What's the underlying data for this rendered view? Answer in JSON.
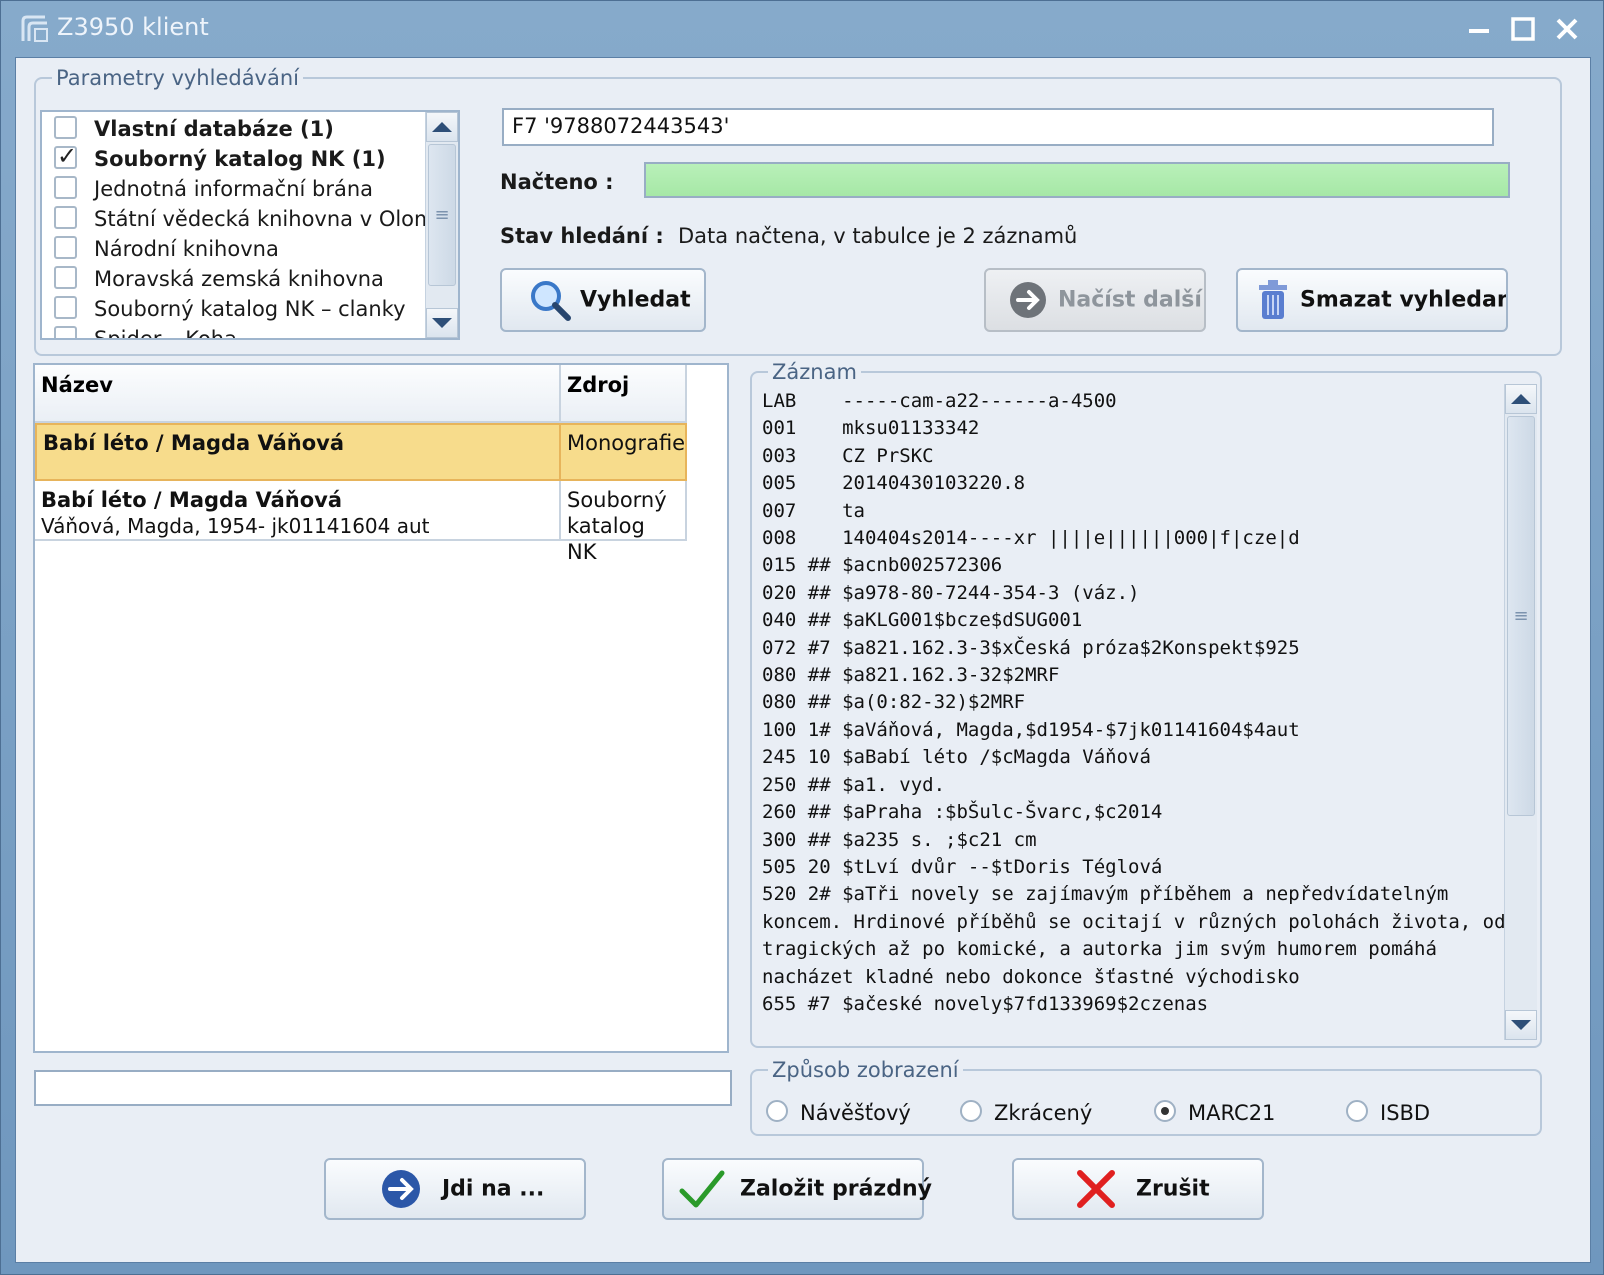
{
  "window": {
    "title": "Z3950 klient",
    "controls": [
      "minimize-icon",
      "maximize-icon",
      "close-icon"
    ]
  },
  "search_params": {
    "legend": "Parametry vyhledávání",
    "databases": [
      {
        "label": "Vlastní databáze (1)",
        "checked": false,
        "bold": true
      },
      {
        "label": "Souborný katalog NK (1)",
        "checked": true,
        "bold": true
      },
      {
        "label": "Jednotná informační brána",
        "checked": false,
        "bold": false
      },
      {
        "label": "Státní vědecká knihovna v Olomouci",
        "checked": false,
        "bold": false
      },
      {
        "label": "Národní knihovna",
        "checked": false,
        "bold": false
      },
      {
        "label": "Moravská zemská knihovna",
        "checked": false,
        "bold": false
      },
      {
        "label": "Souborný katalog NK – clanky",
        "checked": false,
        "bold": false
      },
      {
        "label": "Spider – Koha",
        "checked": false,
        "bold": false
      }
    ],
    "query": "F7 '9788072443543'",
    "loaded_label": "Načteno :",
    "loaded_progress": 1.0,
    "status_label": "Stav hledání :",
    "status_text": "Data načtena, v tabulce je 2 záznamů",
    "search_button": "Vyhledat",
    "load_more_button": "Načíst další",
    "clear_button": "Smazat vyhledané"
  },
  "results": {
    "columns": [
      "Název",
      "Zdroj"
    ],
    "rows": [
      {
        "title": "Babí léto / Magda Váňová",
        "subtitle": "",
        "source": "Monografie",
        "selected": true
      },
      {
        "title": "Babí léto / Magda Váňová",
        "subtitle": "Váňová, Magda, 1954- jk01141604 aut",
        "source": "Souborný katalog NK",
        "selected": false
      }
    ],
    "filter_value": ""
  },
  "record": {
    "legend": "Záznam",
    "text": "LAB    -----cam-a22------a-4500\n001    mksu01133342\n003    CZ PrSKC\n005    20140430103220.8\n007    ta\n008    140404s2014----xr ||||e||||||000|f|cze|d\n015 ## $acnb002572306\n020 ## $a978-80-7244-354-3 (váz.)\n040 ## $aKLG001$bcze$dSUG001\n072 #7 $a821.162.3-3$xČeská próza$2Konspekt$925\n080 ## $a821.162.3-32$2MRF\n080 ## $a(0:82-32)$2MRF\n100 1# $aVáňová, Magda,$d1954-$7jk01141604$4aut\n245 10 $aBabí léto /$cMagda Váňová\n250 ## $a1. vyd.\n260 ## $aPraha :$bŠulc-Švarc,$c2014\n300 ## $a235 s. ;$c21 cm\n505 20 $tLví dvůr --$tDoris Téglová\n520 2# $aTři novely se zajímavým příběhem a nepředvídatelným koncem. Hrdinové příběhů se ocitají v různých polohách života, od tragických až po komické, a autorka jim svým humorem pomáhá nacházet kladné nebo dokonce šťastné východisko\n655 #7 $ačeské novely$7fd133969$2czenas"
  },
  "display_mode": {
    "legend": "Způsob zobrazení",
    "options": [
      "Návěšťový",
      "Zkrácený",
      "MARC21",
      "ISBD"
    ],
    "selected": "MARC21"
  },
  "footer": {
    "goto_button": "Jdi na ...",
    "create_empty_button": "Založit prázdný",
    "cancel_button": "Zrušit"
  },
  "colors": {
    "selected_row": "#f7dc8c",
    "progress_fill": "#a6e8a6",
    "accent_blue": "#2b57a8",
    "cancel_red": "#e02020",
    "ok_green": "#2a9a2a"
  }
}
